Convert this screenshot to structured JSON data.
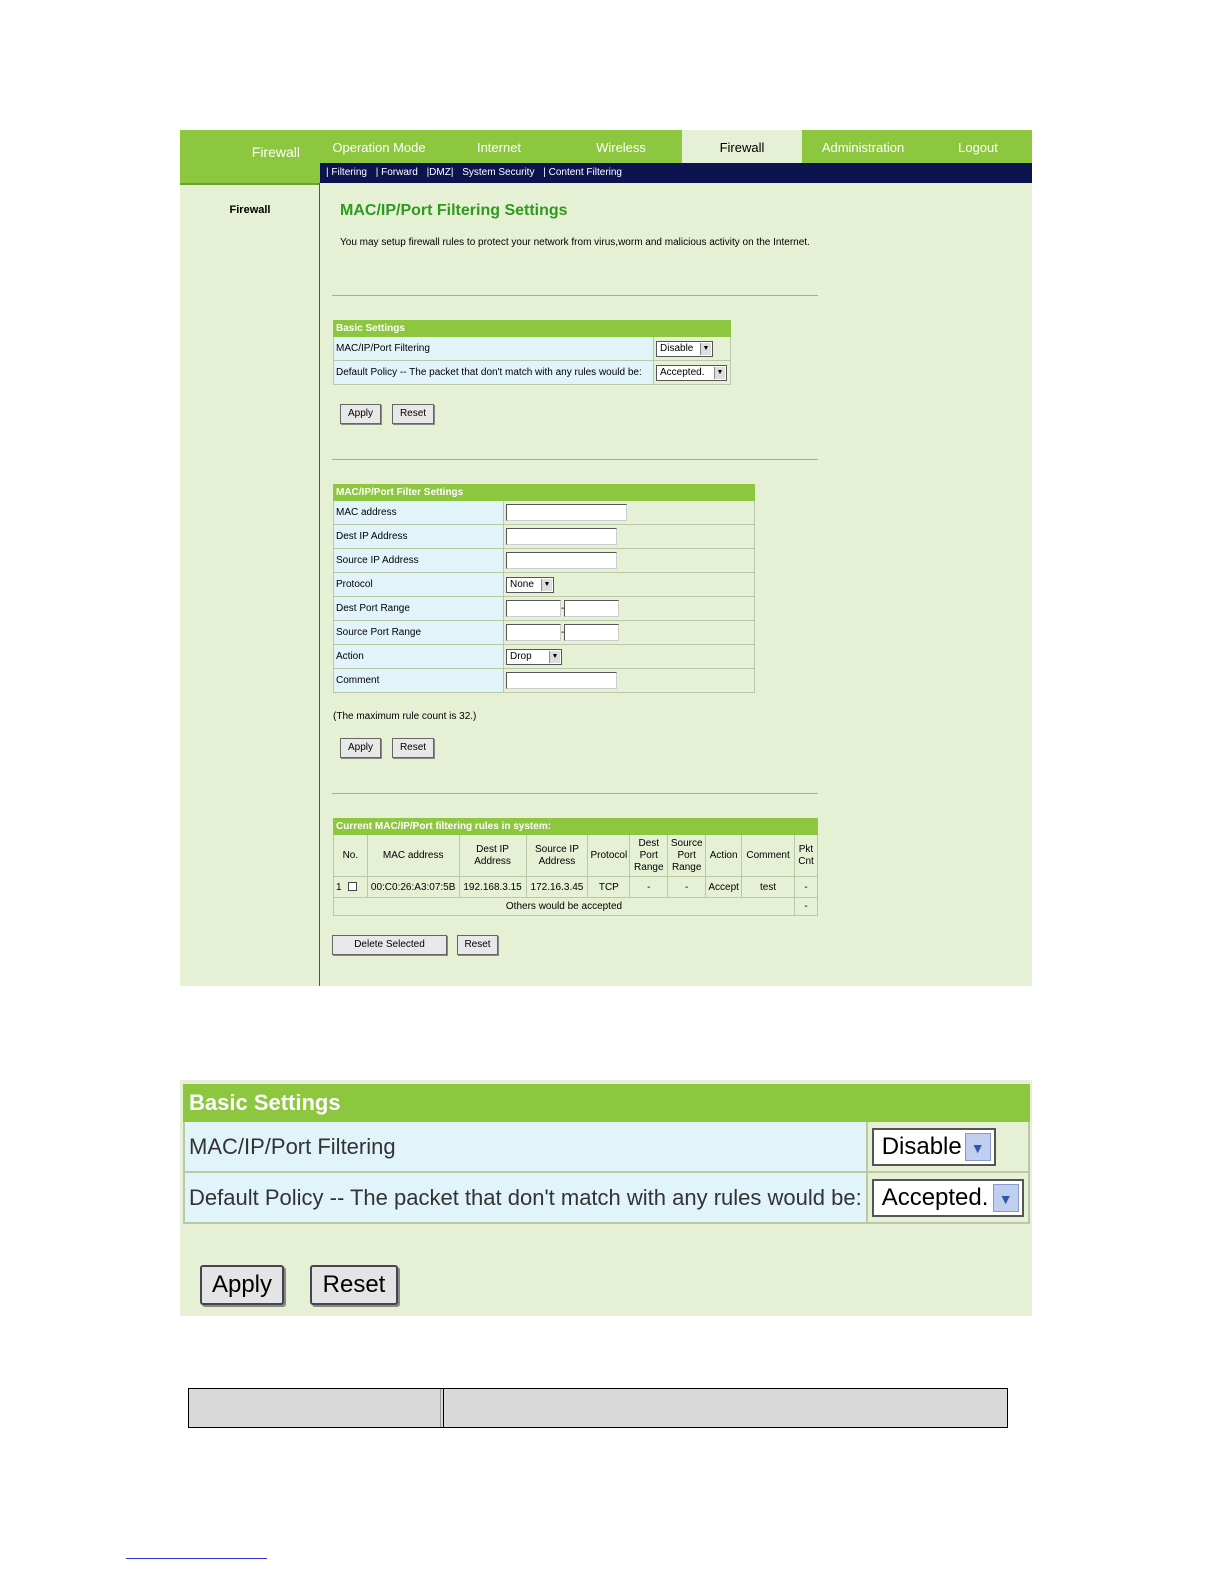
{
  "nav": {
    "brand": "Firewall",
    "tabs": [
      "Operation Mode",
      "Internet",
      "Wireless",
      "Firewall",
      "Administration",
      "Logout"
    ],
    "active": "Firewall",
    "sub": [
      "| Filtering",
      "| Forward",
      "|DMZ|",
      "System Security",
      "| Content Filtering"
    ]
  },
  "sidebar": {
    "label": "Firewall"
  },
  "page": {
    "title": "MAC/IP/Port Filtering Settings",
    "description": "You may setup firewall rules to protect your network from virus,worm and malicious activity on the Internet."
  },
  "basic": {
    "header": "Basic Settings",
    "filtering_label": "MAC/IP/Port Filtering",
    "filtering_value": "Disable",
    "policy_label": "Default Policy -- The packet that don't match with any rules would be:",
    "policy_value": "Accepted.",
    "apply": "Apply",
    "reset": "Reset"
  },
  "filter": {
    "header": "MAC/IP/Port Filter Settings",
    "mac_label": "MAC address",
    "dest_ip_label": "Dest IP Address",
    "src_ip_label": "Source IP Address",
    "protocol_label": "Protocol",
    "protocol_value": "None",
    "dest_port_label": "Dest Port Range",
    "src_port_label": "Source Port Range",
    "action_label": "Action",
    "action_value": "Drop",
    "comment_label": "Comment",
    "range_sep": "-",
    "max_note": "(The maximum rule count is 32.)",
    "apply": "Apply",
    "reset": "Reset"
  },
  "rules": {
    "header": "Current MAC/IP/Port filtering rules in system:",
    "columns": [
      "No.",
      "MAC address",
      "Dest IP Address",
      "Source IP Address",
      "Protocol",
      "Dest Port Range",
      "Source Port Range",
      "Action",
      "Comment",
      "Pkt Cnt"
    ],
    "row": {
      "no": "1",
      "mac": "00:C0:26:A3:07:5B",
      "dest_ip": "192.168.3.15",
      "src_ip": "172.16.3.45",
      "protocol": "TCP",
      "dest_port": "-",
      "src_port": "-",
      "action": "Accept",
      "comment": "test",
      "pkt": "-"
    },
    "others": "Others would be accepted",
    "others_pkt": "-",
    "delete": "Delete Selected",
    "reset": "Reset"
  },
  "zoom": {
    "header": "Basic Settings",
    "filtering_label": "MAC/IP/Port Filtering",
    "filtering_value": "Disable",
    "policy_label": "Default Policy -- The packet that don't match with any rules would be:",
    "policy_value": "Accepted.",
    "apply": "Apply",
    "reset": "Reset"
  },
  "colors": {
    "brand_green": "#8dc63f",
    "title_green": "#2e9a1e",
    "subnav_navy": "#0c1450",
    "page_bg": "#e6f0d4",
    "label_bg": "#e1f4fa"
  }
}
